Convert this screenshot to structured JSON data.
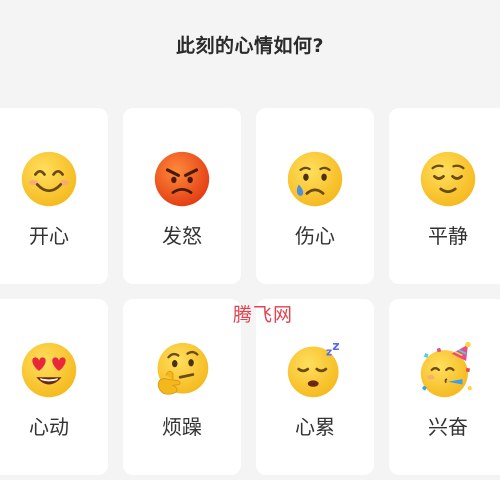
{
  "header": {
    "title": "此刻的心情如何?"
  },
  "moods": [
    {
      "label": "开心",
      "icon": "smiling-face-icon"
    },
    {
      "label": "发怒",
      "icon": "angry-face-icon"
    },
    {
      "label": "伤心",
      "icon": "crying-face-icon"
    },
    {
      "label": "平静",
      "icon": "relieved-face-icon"
    },
    {
      "label": "心动",
      "icon": "heart-eyes-face-icon"
    },
    {
      "label": "烦躁",
      "icon": "thinking-face-icon"
    },
    {
      "label": "心累",
      "icon": "sleepy-face-icon"
    },
    {
      "label": "兴奋",
      "icon": "party-face-icon"
    }
  ],
  "watermark": "腾飞网",
  "colors": {
    "background": "#f4f4f4",
    "card": "#ffffff",
    "emoji_yellow": "#fbc634",
    "angry_red": "#f04a1a",
    "watermark": "#e0424e"
  }
}
